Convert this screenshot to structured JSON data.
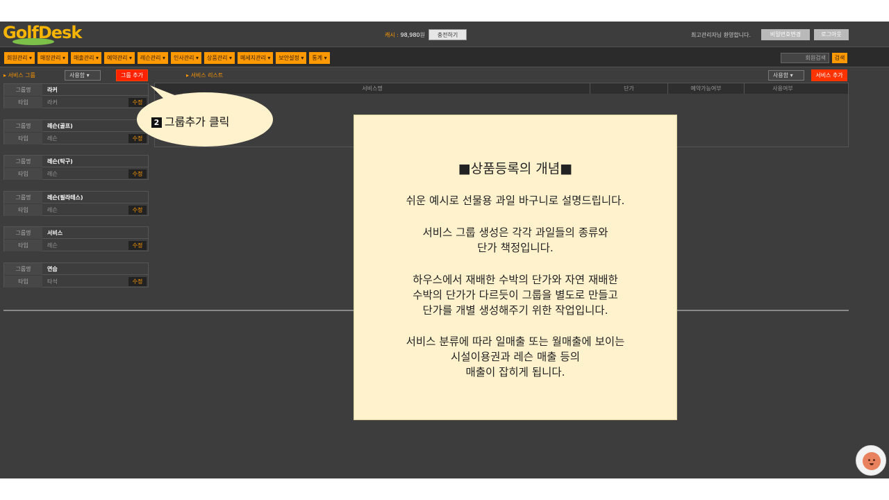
{
  "header": {
    "logo": "GolfDesk",
    "cash_label": "캐시 : ",
    "cash_amount": "98,980",
    "cash_unit": "원",
    "charge_button": "충전하기",
    "welcome": "최고관리자님 환영합니다.",
    "password_button": "비밀번호변경",
    "logout_button": "로그아웃"
  },
  "menu": {
    "items": [
      "회원관리 ▾",
      "매장관리 ▾",
      "매출관리 ▾",
      "예약관리 ▾",
      "레슨관리 ▾",
      "인사관리 ▾",
      "상품관리 ▾",
      "메세지관리 ▾",
      "보안설정 ▾",
      "통계 ▾"
    ],
    "member_search_placeholder": "회원검색",
    "search_button": "검색"
  },
  "groups": {
    "title": "서비스 그룹",
    "filter_value": "사용함",
    "add_button": "그룹 추가",
    "name_label": "그룹명",
    "type_label": "타입",
    "edit_label": "수정",
    "items": [
      {
        "name": "라커",
        "type": "라커"
      },
      {
        "name": "레슨(골프)",
        "type": "레슨"
      },
      {
        "name": "레슨(탁구)",
        "type": "레슨"
      },
      {
        "name": "레슨(필라테스)",
        "type": "레슨"
      },
      {
        "name": "서비스",
        "type": "레슨"
      },
      {
        "name": "연습",
        "type": "타석"
      }
    ]
  },
  "services": {
    "title": "서비스 리스트",
    "filter_value": "사용함",
    "add_button": "서비스 추가",
    "columns": [
      "서비스명",
      "단가",
      "예약가능여부",
      "사용여부"
    ]
  },
  "callout": {
    "number": "2",
    "text": "그룹추가 클릭"
  },
  "info": {
    "title": "■상품등록의 개념■",
    "p1": "쉬운 예시로 선물용 과일 바구니로 설명드립니다.",
    "p2": "서비스 그룹 생성은 각각 과일들의 종류와\n단가 책정입니다.",
    "p3": "하우스에서 재배한 수박의 단가와 자연 재배한\n수박의 단가가 다르듯이 그룹을 별도로 만들고\n단가를 개별 생성해주기 위한 작업입니다.",
    "p4": "서비스 분류에 따라 일매출 또는 월매출에 보이는\n시설이용권과 레슨 매출 등의\n매출이 잡히게 됩니다."
  },
  "colors": {
    "accent": "#ff9900",
    "add_button": "#ff2200",
    "background": "#3d3d3d",
    "info_panel": "#fff2cc"
  }
}
